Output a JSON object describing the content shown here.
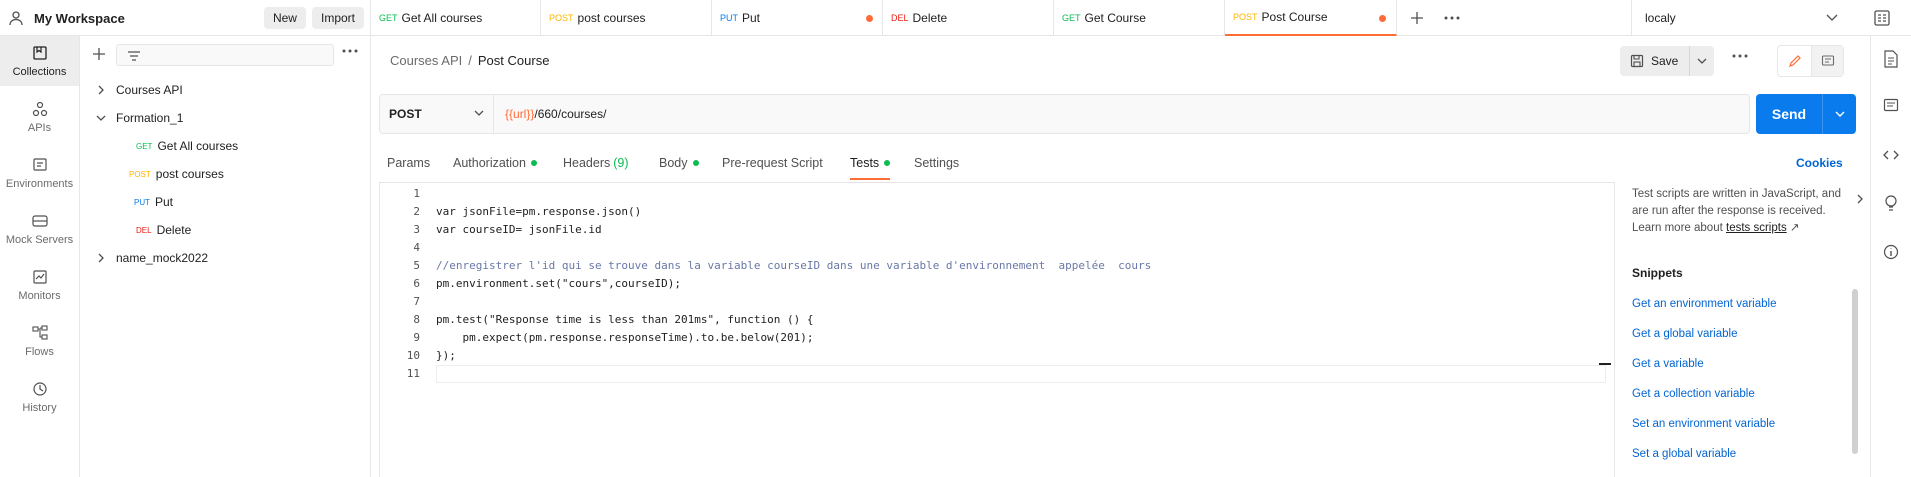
{
  "workspace": {
    "name": "My Workspace",
    "new_label": "New",
    "import_label": "Import"
  },
  "tabs": [
    {
      "method": "GET",
      "label": "Get All courses",
      "method_color": "#0cbb52",
      "unsaved": false,
      "active": false
    },
    {
      "method": "POST",
      "label": "post courses",
      "method_color": "#ffb400",
      "unsaved": false,
      "active": false
    },
    {
      "method": "PUT",
      "label": "Put",
      "method_color": "#097bed",
      "unsaved": true,
      "active": false
    },
    {
      "method": "DEL",
      "label": "Delete",
      "method_color": "#eb2013",
      "unsaved": false,
      "active": false
    },
    {
      "method": "GET",
      "label": "Get Course",
      "method_color": "#0cbb52",
      "unsaved": false,
      "active": false
    },
    {
      "method": "POST",
      "label": "Post Course",
      "method_color": "#ffb400",
      "unsaved": true,
      "active": true
    }
  ],
  "environment": {
    "selected": "localy"
  },
  "rail": [
    {
      "label": "Collections",
      "icon": "collections-icon",
      "active": true
    },
    {
      "label": "APIs",
      "icon": "apis-icon",
      "active": false
    },
    {
      "label": "Environments",
      "icon": "environments-icon",
      "active": false
    },
    {
      "label": "Mock Servers",
      "icon": "mock-servers-icon",
      "active": false
    },
    {
      "label": "Monitors",
      "icon": "monitors-icon",
      "active": false
    },
    {
      "label": "Flows",
      "icon": "flows-icon",
      "active": false
    },
    {
      "label": "History",
      "icon": "history-icon",
      "active": false
    }
  ],
  "tree": [
    {
      "label": "Courses API",
      "type": "collection",
      "expanded": false
    },
    {
      "label": "Formation_1",
      "type": "collection",
      "expanded": true
    },
    {
      "label": "Get All courses",
      "type": "request",
      "method": "GET"
    },
    {
      "label": "post courses",
      "type": "request",
      "method": "POST"
    },
    {
      "label": "Put",
      "type": "request",
      "method": "PUT"
    },
    {
      "label": "Delete",
      "type": "request",
      "method": "DEL"
    },
    {
      "label": "name_mock2022",
      "type": "collection",
      "expanded": false
    }
  ],
  "breadcrumb": {
    "parent": "Courses API",
    "separator": "/",
    "current": "Post Course"
  },
  "toolbar": {
    "save_label": "Save"
  },
  "request": {
    "method": "POST",
    "url_var": "{{url}}",
    "url_path": "/660/courses/",
    "send_label": "Send"
  },
  "request_tabs": [
    {
      "label": "Params",
      "count": "",
      "dot": false,
      "active": false
    },
    {
      "label": "Authorization",
      "count": "",
      "dot": true,
      "active": false
    },
    {
      "label": "Headers",
      "count": "(9)",
      "dot": false,
      "active": false
    },
    {
      "label": "Body",
      "count": "",
      "dot": true,
      "active": false
    },
    {
      "label": "Pre-request Script",
      "count": "",
      "dot": false,
      "active": false
    },
    {
      "label": "Tests",
      "count": "",
      "dot": true,
      "active": true
    },
    {
      "label": "Settings",
      "count": "",
      "dot": false,
      "active": false
    }
  ],
  "cookies_label": "Cookies",
  "code_lines": [
    "",
    "var jsonFile=pm.response.json()",
    "var courseID= jsonFile.id",
    "",
    "//enregistrer l'id qui se trouve dans la variable courseID dans une variable d'environnement  appelée  cours",
    "pm.environment.set(\"cours\",courseID);",
    "",
    "pm.test(\"Response time is less than 201ms\", function () {",
    "    pm.expect(pm.response.responseTime).to.be.below(201);",
    "});",
    ""
  ],
  "help": {
    "description": "Test scripts are written in JavaScript, and are run after the response is received. Learn more about",
    "link": "tests scripts",
    "link_arrow": "↗",
    "snippets_title": "Snippets",
    "snippets": [
      "Get an environment variable",
      "Get a global variable",
      "Get a variable",
      "Get a collection variable",
      "Set an environment variable",
      "Set a global variable"
    ]
  }
}
